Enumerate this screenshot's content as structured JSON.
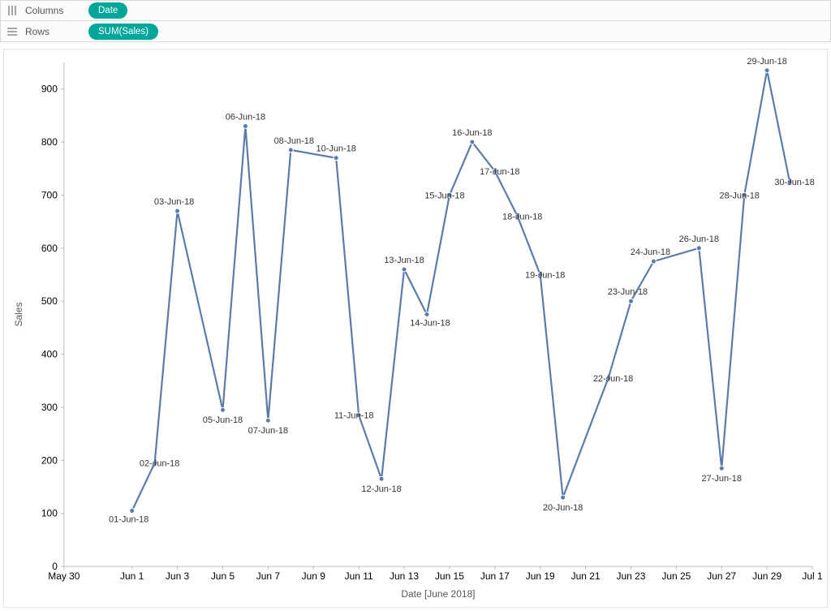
{
  "shelves": {
    "columns_label": "Columns",
    "rows_label": "Rows",
    "columns_pill": "Date",
    "rows_pill": "SUM(Sales)"
  },
  "chart_data": {
    "type": "line",
    "xlabel": "Date [June 2018]",
    "ylabel": "Sales",
    "ylim": [
      0,
      950
    ],
    "x_ticks": [
      "May 30",
      "Jun 1",
      "Jun 3",
      "Jun 5",
      "Jun 7",
      "Jun 9",
      "Jun 11",
      "Jun 13",
      "Jun 15",
      "Jun 17",
      "Jun 19",
      "Jun 21",
      "Jun 23",
      "Jun 25",
      "Jun 27",
      "Jun 29",
      "Jul 1"
    ],
    "y_ticks": [
      0,
      100,
      200,
      300,
      400,
      500,
      600,
      700,
      800,
      900
    ],
    "points": [
      {
        "day": 1,
        "label": "01-Jun-18",
        "value": 105,
        "labelPos": "below-left"
      },
      {
        "day": 2,
        "label": "02-Jun-18",
        "value": 195,
        "labelPos": "right"
      },
      {
        "day": 3,
        "label": "03-Jun-18",
        "value": 670,
        "labelPos": "above-left"
      },
      {
        "day": 5,
        "label": "05-Jun-18",
        "value": 295,
        "labelPos": "below"
      },
      {
        "day": 6,
        "label": "06-Jun-18",
        "value": 830,
        "labelPos": "above"
      },
      {
        "day": 7,
        "label": "07-Jun-18",
        "value": 275,
        "labelPos": "below"
      },
      {
        "day": 8,
        "label": "08-Jun-18",
        "value": 785,
        "labelPos": "above-right"
      },
      {
        "day": 10,
        "label": "10-Jun-18",
        "value": 770,
        "labelPos": "above"
      },
      {
        "day": 11,
        "label": "11-Jun-18",
        "value": 285,
        "labelPos": "left"
      },
      {
        "day": 12,
        "label": "12-Jun-18",
        "value": 165,
        "labelPos": "below"
      },
      {
        "day": 13,
        "label": "13-Jun-18",
        "value": 560,
        "labelPos": "above"
      },
      {
        "day": 14,
        "label": "14-Jun-18",
        "value": 475,
        "labelPos": "below-right"
      },
      {
        "day": 15,
        "label": "15-Jun-18",
        "value": 700,
        "labelPos": "left"
      },
      {
        "day": 16,
        "label": "16-Jun-18",
        "value": 800,
        "labelPos": "above"
      },
      {
        "day": 17,
        "label": "17-Jun-18",
        "value": 745,
        "labelPos": "right"
      },
      {
        "day": 18,
        "label": "18-Jun-18",
        "value": 660,
        "labelPos": "right"
      },
      {
        "day": 19,
        "label": "19-Jun-18",
        "value": 550,
        "labelPos": "right"
      },
      {
        "day": 20,
        "label": "20-Jun-18",
        "value": 130,
        "labelPos": "below"
      },
      {
        "day": 22,
        "label": "22-Jun-18",
        "value": 355,
        "labelPos": "right"
      },
      {
        "day": 23,
        "label": "23-Jun-18",
        "value": 500,
        "labelPos": "above-left"
      },
      {
        "day": 24,
        "label": "24-Jun-18",
        "value": 575,
        "labelPos": "above-left"
      },
      {
        "day": 26,
        "label": "26-Jun-18",
        "value": 600,
        "labelPos": "above"
      },
      {
        "day": 27,
        "label": "27-Jun-18",
        "value": 185,
        "labelPos": "below"
      },
      {
        "day": 28,
        "label": "28-Jun-18",
        "value": 700,
        "labelPos": "left"
      },
      {
        "day": 29,
        "label": "29-Jun-18",
        "value": 935,
        "labelPos": "above"
      },
      {
        "day": 30,
        "label": "30-Jun-18",
        "value": 725,
        "labelPos": "right"
      }
    ]
  }
}
